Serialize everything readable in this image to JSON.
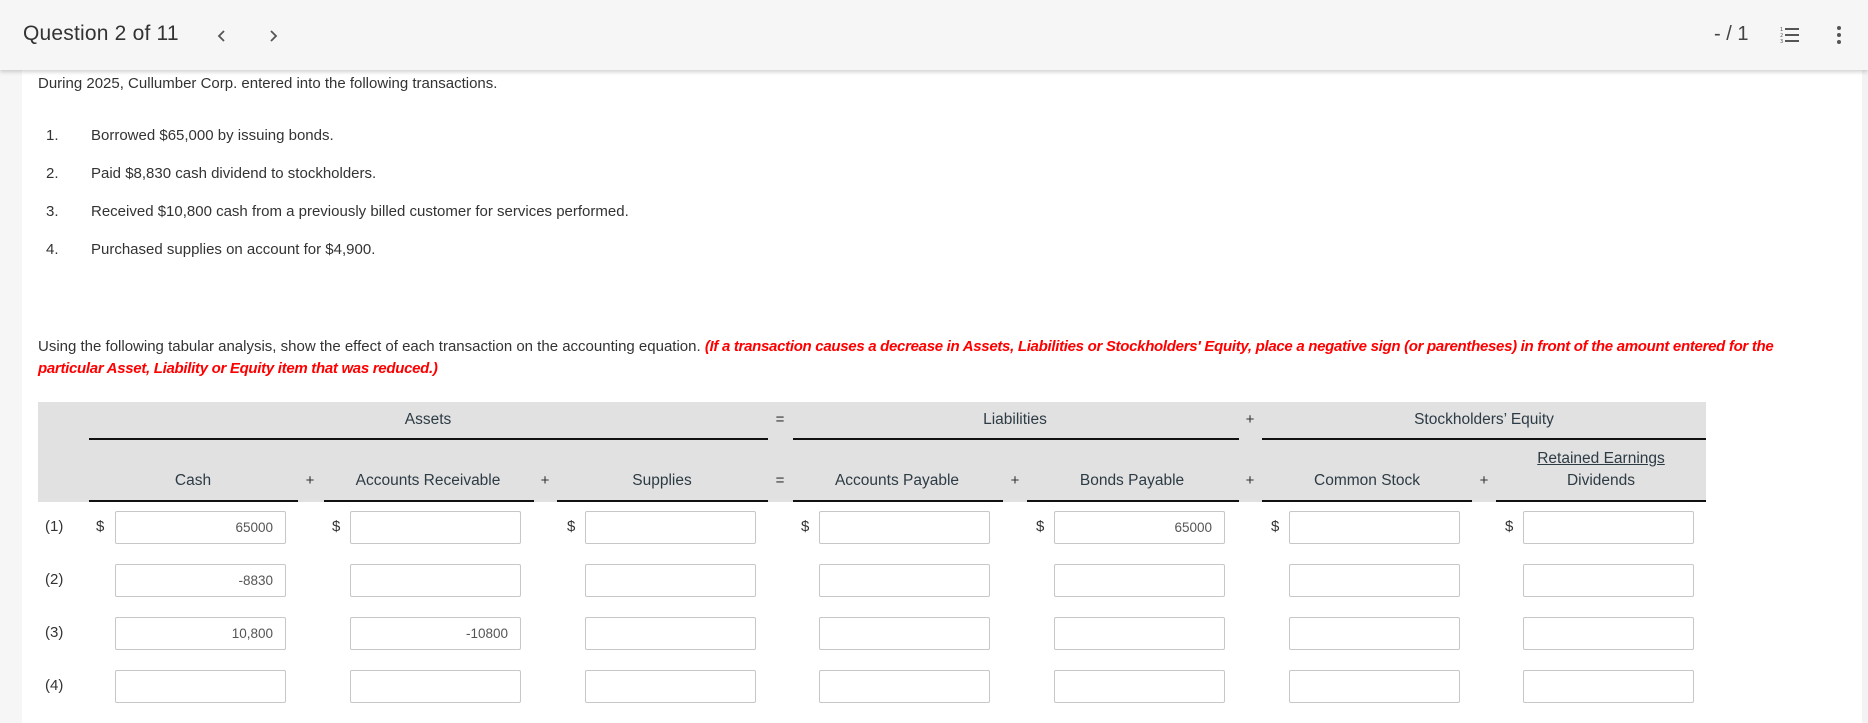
{
  "topbar": {
    "question_label": "Question 2 of 11",
    "prev_icon": "chevron-left-icon",
    "next_icon": "chevron-right-icon",
    "score": "- / 1",
    "list_icon": "numbered-list-icon",
    "more_icon": "more-vertical-icon"
  },
  "question": {
    "intro": "During 2025, Cullumber Corp. entered into the following transactions.",
    "transactions": [
      {
        "num": "1.",
        "text": "Borrowed $65,000 by issuing bonds."
      },
      {
        "num": "2.",
        "text": "Paid $8,830 cash dividend to stockholders."
      },
      {
        "num": "3.",
        "text": "Received $10,800 cash from a previously billed customer for services performed."
      },
      {
        "num": "4.",
        "text": "Purchased supplies on account for $4,900."
      }
    ],
    "instruction": "Using the following tabular analysis, show the effect of each transaction on the accounting equation.",
    "warning": "(If a transaction causes a decrease in Assets, Liabilities or Stockholders' Equity, place a negative sign (or parentheses) in front of the amount entered for the particular Asset, Liability or Equity item that was reduced.)",
    "warning_color": "#ff0000"
  },
  "table": {
    "groups": {
      "assets": "Assets",
      "liabilities": "Liabilities",
      "equity": "Stockholders’ Equity"
    },
    "operators": {
      "eq": "=",
      "plus": "+"
    },
    "columns": [
      {
        "key": "cash",
        "label": "Cash"
      },
      {
        "key": "ar",
        "label": "Accounts Receivable"
      },
      {
        "key": "supplies",
        "label": "Supplies"
      },
      {
        "key": "ap",
        "label": "Accounts Payable"
      },
      {
        "key": "bp",
        "label": "Bonds Payable"
      },
      {
        "key": "cs",
        "label": "Common Stock"
      },
      {
        "key": "re",
        "label": "Dividends",
        "super_label": "Retained Earnings"
      }
    ],
    "currency_symbol": "$",
    "rows": [
      {
        "label": "(1)",
        "values": [
          "65000",
          "",
          "",
          "",
          "65000",
          "",
          ""
        ]
      },
      {
        "label": "(2)",
        "values": [
          "-8830",
          "",
          "",
          "",
          "",
          "",
          ""
        ]
      },
      {
        "label": "(3)",
        "values": [
          "10,800",
          "-10800",
          "",
          "",
          "",
          "",
          ""
        ]
      },
      {
        "label": "(4)",
        "values": [
          "",
          "",
          "",
          "",
          "",
          "",
          ""
        ]
      }
    ]
  }
}
